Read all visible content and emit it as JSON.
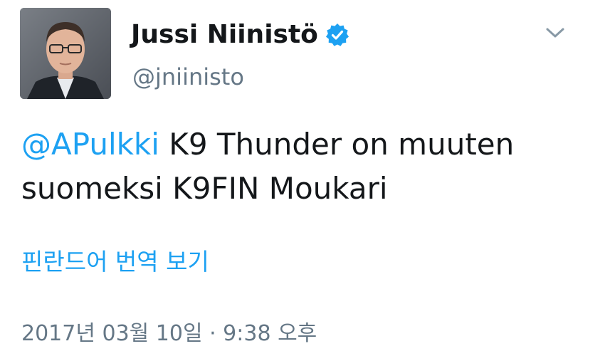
{
  "author": {
    "display_name": "Jussi Niinistö",
    "handle": "@jniinisto",
    "verified": true
  },
  "tweet": {
    "mention": "@APulkki",
    "text": " K9 Thunder on muuten suomeksi K9FIN Moukari"
  },
  "translate_link": "핀란드어 번역 보기",
  "timestamp": "2017년 03월 10일 · 9:38 오후",
  "colors": {
    "accent": "#1da1f2",
    "text": "#14171a",
    "muted": "#657786"
  },
  "icons": {
    "verified": "verified-badge-icon",
    "menu": "chevron-down-icon"
  }
}
